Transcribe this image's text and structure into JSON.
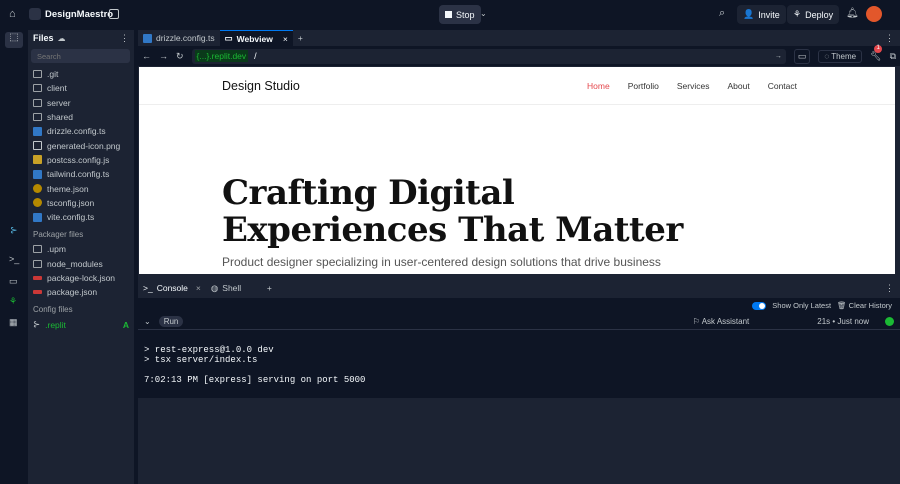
{
  "topbar": {
    "app_name": "DesignMaestro",
    "stop": "Stop",
    "invite": "Invite",
    "deploy": "Deploy"
  },
  "files": {
    "title": "Files",
    "search_placeholder": "Search",
    "items": [
      {
        "name": ".git",
        "icon": "folder"
      },
      {
        "name": "client",
        "icon": "folder"
      },
      {
        "name": "server",
        "icon": "folder"
      },
      {
        "name": "shared",
        "icon": "folder"
      },
      {
        "name": "drizzle.config.ts",
        "icon": "ts"
      },
      {
        "name": "generated-icon.png",
        "icon": "image"
      },
      {
        "name": "postcss.config.js",
        "icon": "js"
      },
      {
        "name": "tailwind.config.ts",
        "icon": "ts"
      },
      {
        "name": "theme.json",
        "icon": "json"
      },
      {
        "name": "tsconfig.json",
        "icon": "json"
      },
      {
        "name": "vite.config.ts",
        "icon": "ts"
      }
    ],
    "packager_title": "Packager files",
    "packager": [
      {
        "name": ".upm",
        "icon": "folder"
      },
      {
        "name": "node_modules",
        "icon": "folder"
      },
      {
        "name": "package-lock.json",
        "icon": "npm"
      },
      {
        "name": "package.json",
        "icon": "npm"
      }
    ],
    "config_title": "Config files",
    "config": [
      {
        "name": ".replit",
        "badge": "A"
      }
    ]
  },
  "tabs": [
    {
      "label": "drizzle.config.ts"
    },
    {
      "label": "Webview"
    }
  ],
  "urlbar": {
    "host": "{...}.replit.dev",
    "path": "/",
    "theme": "Theme",
    "notif": "1"
  },
  "site": {
    "brand": "Design Studio",
    "nav": [
      "Home",
      "Portfolio",
      "Services",
      "About",
      "Contact"
    ],
    "heading1": "Crafting Digital",
    "heading2": "Experiences That Matter",
    "sub": "Product designer specializing in user-centered design solutions that drive business"
  },
  "console": {
    "tabs": [
      "Console",
      "Shell"
    ],
    "show_latest": "Show Only Latest",
    "clear": "Clear History",
    "run": "Run",
    "ask": "Ask Assistant",
    "time": "21s • Just now",
    "lines": [
      "> rest-express@1.0.0 dev",
      "> tsx server/index.ts",
      "",
      "7:02:13 PM [express] serving on port 5000"
    ]
  },
  "colors": {
    "accent": "#0079f2",
    "active_nav": "#e5484d",
    "green": "#1bb934"
  }
}
